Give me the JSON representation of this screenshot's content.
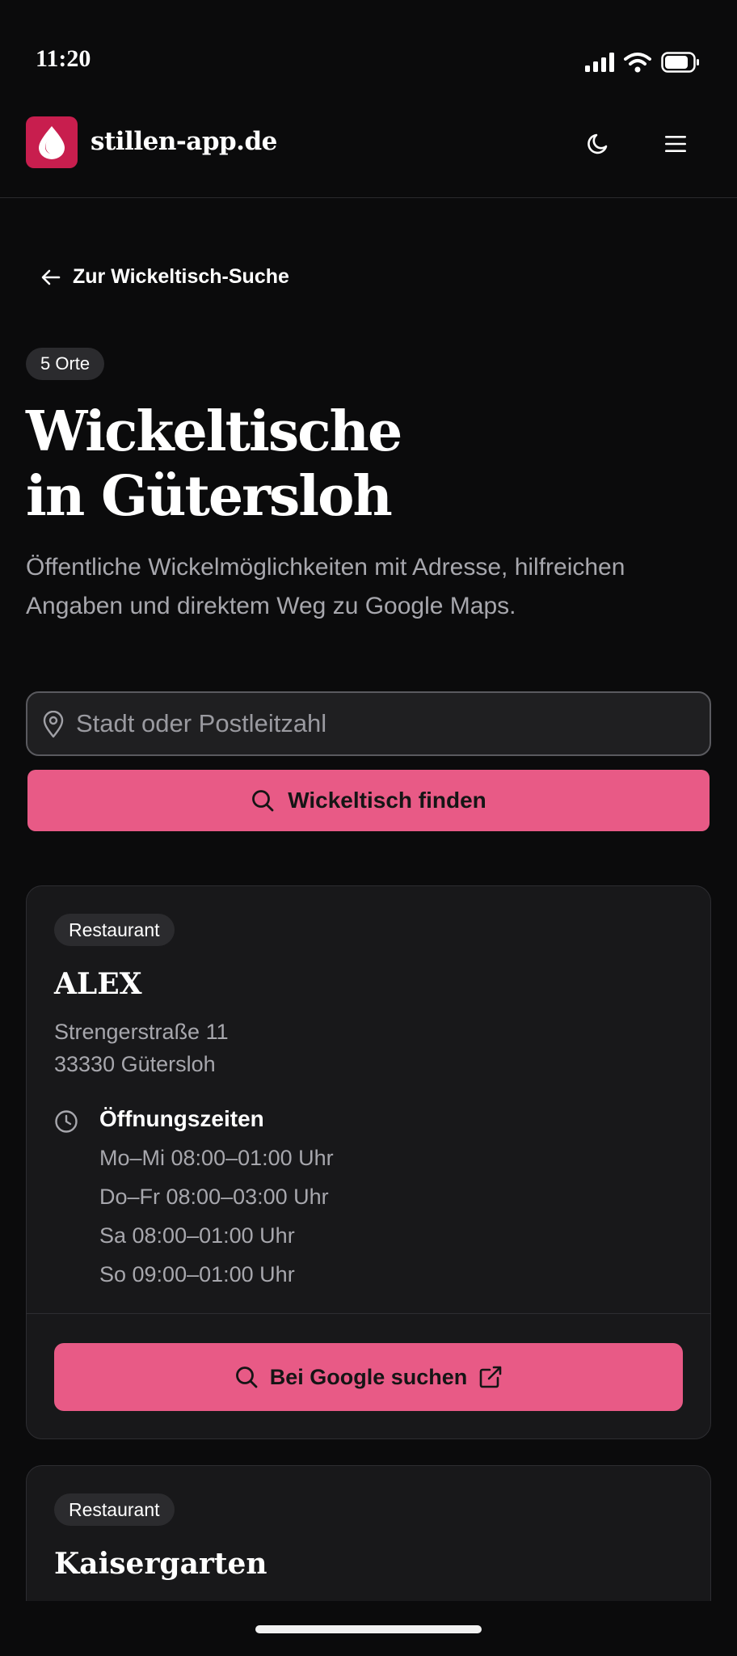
{
  "status_bar": {
    "time": "11:20"
  },
  "header": {
    "site_name": "stillen-app.de",
    "theme_toggle_icon": "moon-icon",
    "menu_icon": "hamburger-menu-icon"
  },
  "back_link": {
    "label": "Zur Wickeltisch-Suche"
  },
  "count_badge": "5 Orte",
  "title": {
    "line1": "Wickeltische",
    "line2": "in Gütersloh"
  },
  "subtitle": "Öffentliche Wickelmöglichkeiten mit Adresse, hilfreichen Angaben und direktem Weg zu Google Maps.",
  "search": {
    "placeholder": "Stadt oder Postleitzahl",
    "value": "",
    "button_label": "Wickeltisch finden"
  },
  "colors": {
    "accent": "#e85a86",
    "logo": "#c81e4e",
    "background": "#0b0b0c",
    "card": "#18181a"
  },
  "places": [
    {
      "type": "Restaurant",
      "name": "ALEX",
      "street": "Strengerstraße 11",
      "city": "33330 Gütersloh",
      "hours_title": "Öffnungszeiten",
      "hours": [
        "Mo–Mi 08:00–01:00 Uhr",
        "Do–Fr 08:00–03:00 Uhr",
        "Sa 08:00–01:00 Uhr",
        "So 09:00–01:00 Uhr"
      ],
      "button_label": "Bei Google suchen"
    },
    {
      "type": "Restaurant",
      "name": "Kaisergarten"
    }
  ]
}
